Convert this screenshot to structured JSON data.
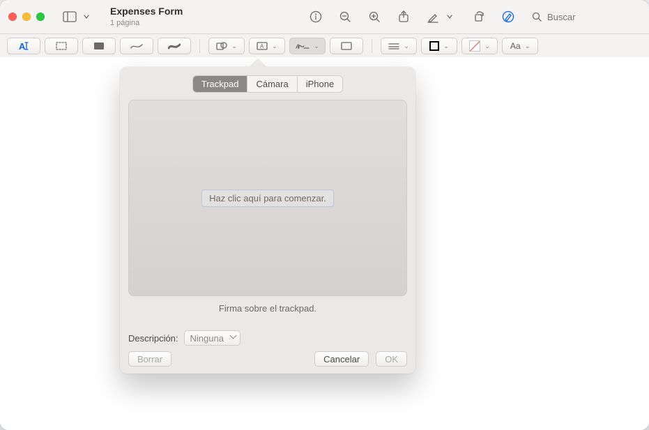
{
  "window": {
    "title": "Expenses Form",
    "subtitle": "1 página"
  },
  "toolbar": {
    "search_placeholder": "Buscar"
  },
  "signature": {
    "tabs": {
      "trackpad": "Trackpad",
      "camera": "Cámara",
      "iphone": "iPhone",
      "selected": "trackpad"
    },
    "pad_hint": "Haz clic aquí para comenzar.",
    "caption": "Firma sobre el trackpad.",
    "description_label": "Descripción:",
    "description_value": "Ninguna",
    "buttons": {
      "clear": "Borrar",
      "cancel": "Cancelar",
      "ok": "OK"
    }
  }
}
